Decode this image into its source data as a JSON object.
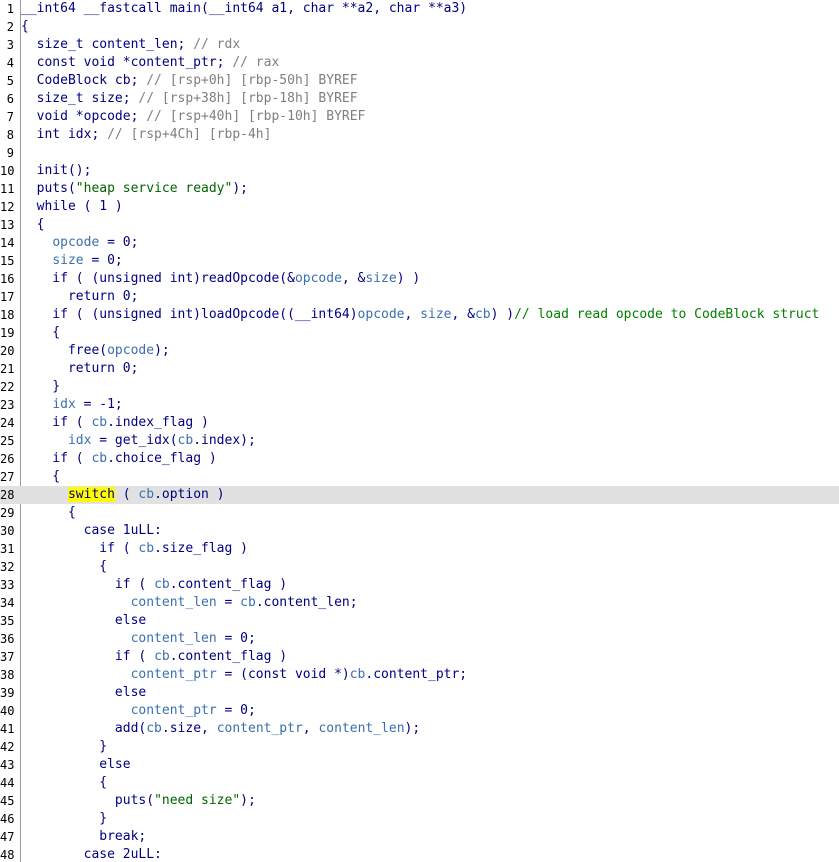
{
  "editor": {
    "current_line": 28,
    "lines": [
      [
        [
          "c-pl",
          "__int64 __fastcall main(__int64 a1, char **a2, char **a3)"
        ]
      ],
      [
        [
          "c-pl",
          "{"
        ]
      ],
      [
        [
          "c-pl",
          "  size_t content_len; "
        ],
        [
          "c-com",
          "// rdx"
        ]
      ],
      [
        [
          "c-pl",
          "  const void *content_ptr; "
        ],
        [
          "c-com",
          "// rax"
        ]
      ],
      [
        [
          "c-pl",
          "  CodeBlock cb; "
        ],
        [
          "c-com",
          "// [rsp+0h] [rbp-50h] BYREF"
        ]
      ],
      [
        [
          "c-pl",
          "  size_t size; "
        ],
        [
          "c-com",
          "// [rsp+38h] [rbp-18h] BYREF"
        ]
      ],
      [
        [
          "c-pl",
          "  void *opcode; "
        ],
        [
          "c-com",
          "// [rsp+40h] [rbp-10h] BYREF"
        ]
      ],
      [
        [
          "c-pl",
          "  int idx; "
        ],
        [
          "c-com",
          "// [rsp+4Ch] [rbp-4h]"
        ]
      ],
      [
        [
          "c-pl",
          ""
        ]
      ],
      [
        [
          "c-pl",
          "  init();"
        ]
      ],
      [
        [
          "c-pl",
          "  puts("
        ],
        [
          "c-str",
          "\"heap service ready\""
        ],
        [
          "c-pl",
          ");"
        ]
      ],
      [
        [
          "c-pl",
          "  while ( 1 )"
        ]
      ],
      [
        [
          "c-pl",
          "  {"
        ]
      ],
      [
        [
          "c-pl",
          "    "
        ],
        [
          "c-var",
          "opcode"
        ],
        [
          "c-pl",
          " = 0;"
        ]
      ],
      [
        [
          "c-pl",
          "    "
        ],
        [
          "c-var",
          "size"
        ],
        [
          "c-pl",
          " = 0;"
        ]
      ],
      [
        [
          "c-pl",
          "    if ( (unsigned int)readOpcode(&"
        ],
        [
          "c-var",
          "opcode"
        ],
        [
          "c-pl",
          ", &"
        ],
        [
          "c-var",
          "size"
        ],
        [
          "c-pl",
          ") )"
        ]
      ],
      [
        [
          "c-pl",
          "      return 0;"
        ]
      ],
      [
        [
          "c-pl",
          "    if ( (unsigned int)loadOpcode((__int64)"
        ],
        [
          "c-var",
          "opcode"
        ],
        [
          "c-pl",
          ", "
        ],
        [
          "c-var",
          "size"
        ],
        [
          "c-pl",
          ", &"
        ],
        [
          "c-var",
          "cb"
        ],
        [
          "c-pl",
          ") )"
        ],
        [
          "c-cmt",
          "// load read opcode to CodeBlock struct"
        ]
      ],
      [
        [
          "c-pl",
          "    {"
        ]
      ],
      [
        [
          "c-pl",
          "      free("
        ],
        [
          "c-var",
          "opcode"
        ],
        [
          "c-pl",
          ");"
        ]
      ],
      [
        [
          "c-pl",
          "      return 0;"
        ]
      ],
      [
        [
          "c-pl",
          "    }"
        ]
      ],
      [
        [
          "c-pl",
          "    "
        ],
        [
          "c-var",
          "idx"
        ],
        [
          "c-pl",
          " = -1;"
        ]
      ],
      [
        [
          "c-pl",
          "    if ( "
        ],
        [
          "c-var",
          "cb"
        ],
        [
          "c-pl",
          ".index_flag )"
        ]
      ],
      [
        [
          "c-pl",
          "      "
        ],
        [
          "c-var",
          "idx"
        ],
        [
          "c-pl",
          " = get_idx("
        ],
        [
          "c-var",
          "cb"
        ],
        [
          "c-pl",
          ".index);"
        ]
      ],
      [
        [
          "c-pl",
          "    if ( "
        ],
        [
          "c-var",
          "cb"
        ],
        [
          "c-pl",
          ".choice_flag )"
        ]
      ],
      [
        [
          "c-pl",
          "    {"
        ]
      ],
      [
        [
          "c-pl",
          "      "
        ],
        [
          "hl-yellow",
          "switch"
        ],
        [
          "c-pl",
          " ( "
        ],
        [
          "c-var",
          "cb"
        ],
        [
          "c-pl",
          ".option )"
        ]
      ],
      [
        [
          "c-pl",
          "      {"
        ]
      ],
      [
        [
          "c-pl",
          "        case 1uLL:"
        ]
      ],
      [
        [
          "c-pl",
          "          if ( "
        ],
        [
          "c-var",
          "cb"
        ],
        [
          "c-pl",
          ".size_flag )"
        ]
      ],
      [
        [
          "c-pl",
          "          {"
        ]
      ],
      [
        [
          "c-pl",
          "            if ( "
        ],
        [
          "c-var",
          "cb"
        ],
        [
          "c-pl",
          ".content_flag )"
        ]
      ],
      [
        [
          "c-pl",
          "              "
        ],
        [
          "c-var",
          "content_len"
        ],
        [
          "c-pl",
          " = "
        ],
        [
          "c-var",
          "cb"
        ],
        [
          "c-pl",
          ".content_len;"
        ]
      ],
      [
        [
          "c-pl",
          "            else"
        ]
      ],
      [
        [
          "c-pl",
          "              "
        ],
        [
          "c-var",
          "content_len"
        ],
        [
          "c-pl",
          " = 0;"
        ]
      ],
      [
        [
          "c-pl",
          "            if ( "
        ],
        [
          "c-var",
          "cb"
        ],
        [
          "c-pl",
          ".content_flag )"
        ]
      ],
      [
        [
          "c-pl",
          "              "
        ],
        [
          "c-var",
          "content_ptr"
        ],
        [
          "c-pl",
          " = (const void *)"
        ],
        [
          "c-var",
          "cb"
        ],
        [
          "c-pl",
          ".content_ptr;"
        ]
      ],
      [
        [
          "c-pl",
          "            else"
        ]
      ],
      [
        [
          "c-pl",
          "              "
        ],
        [
          "c-var",
          "content_ptr"
        ],
        [
          "c-pl",
          " = 0;"
        ]
      ],
      [
        [
          "c-pl",
          "            add("
        ],
        [
          "c-var",
          "cb"
        ],
        [
          "c-pl",
          ".size, "
        ],
        [
          "c-var",
          "content_ptr"
        ],
        [
          "c-pl",
          ", "
        ],
        [
          "c-var",
          "content_len"
        ],
        [
          "c-pl",
          ");"
        ]
      ],
      [
        [
          "c-pl",
          "          }"
        ]
      ],
      [
        [
          "c-pl",
          "          else"
        ]
      ],
      [
        [
          "c-pl",
          "          {"
        ]
      ],
      [
        [
          "c-pl",
          "            puts("
        ],
        [
          "c-str",
          "\"need size\""
        ],
        [
          "c-pl",
          ");"
        ]
      ],
      [
        [
          "c-pl",
          "          }"
        ]
      ],
      [
        [
          "c-pl",
          "          break;"
        ]
      ],
      [
        [
          "c-pl",
          "        case 2uLL:"
        ]
      ]
    ]
  }
}
